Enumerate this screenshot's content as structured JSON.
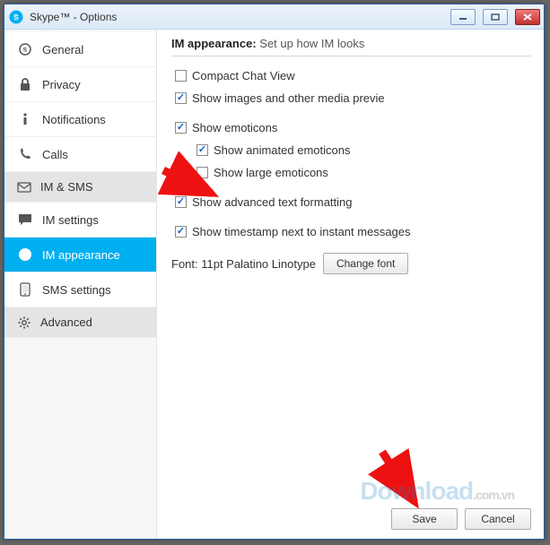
{
  "window": {
    "title": "Skype™ - Options"
  },
  "sidebar": {
    "items": {
      "general": {
        "label": "General"
      },
      "privacy": {
        "label": "Privacy"
      },
      "notifications": {
        "label": "Notifications"
      },
      "calls": {
        "label": "Calls"
      },
      "imsms": {
        "label": "IM & SMS"
      },
      "imsettings": {
        "label": "IM settings"
      },
      "imappearance": {
        "label": "IM appearance"
      },
      "smssettings": {
        "label": "SMS settings"
      },
      "advanced": {
        "label": "Advanced"
      }
    }
  },
  "content": {
    "heading_strong": "IM appearance:",
    "heading_rest": " Set up how IM looks",
    "opts": {
      "compact": {
        "label": "Compact Chat View",
        "checked": false
      },
      "images": {
        "label": "Show images and other media previe",
        "checked": true
      },
      "emoticons": {
        "label": "Show emoticons",
        "checked": true
      },
      "animated": {
        "label": "Show animated emoticons",
        "checked": true
      },
      "large": {
        "label": "Show large emoticons",
        "checked": false
      },
      "advfmt": {
        "label": "Show advanced text formatting",
        "checked": true
      },
      "timestamp": {
        "label": "Show timestamp next to instant messages",
        "checked": true
      }
    },
    "font_label": "Font: 11pt Palatino Linotype",
    "change_font_btn": "Change font"
  },
  "footer": {
    "save": "Save",
    "cancel": "Cancel"
  },
  "watermark": {
    "main": "Download",
    "tail": ".com.vn"
  }
}
